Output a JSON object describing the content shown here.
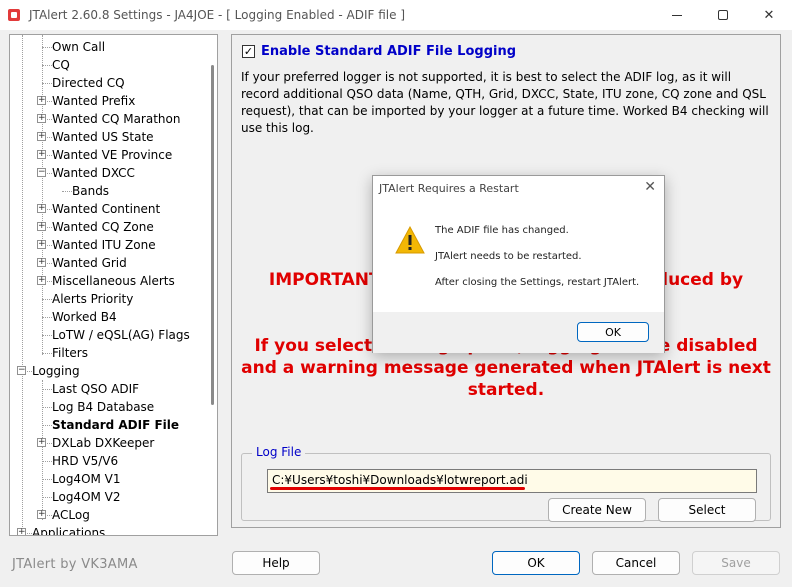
{
  "window": {
    "title": "JTAlert 2.60.8 Settings  -  JA4JOE  -  [ Logging Enabled - ADIF file ]",
    "controls": {
      "minimize": "minimize",
      "maximize": "maximize",
      "close": "✕"
    }
  },
  "tree": {
    "items": [
      {
        "label": "Own Call",
        "level": 2,
        "expander": ""
      },
      {
        "label": "CQ",
        "level": 2,
        "expander": ""
      },
      {
        "label": "Directed CQ",
        "level": 2,
        "expander": ""
      },
      {
        "label": "Wanted Prefix",
        "level": 2,
        "expander": "+"
      },
      {
        "label": "Wanted CQ Marathon",
        "level": 2,
        "expander": "+"
      },
      {
        "label": "Wanted US State",
        "level": 2,
        "expander": "+"
      },
      {
        "label": "Wanted VE Province",
        "level": 2,
        "expander": "+"
      },
      {
        "label": "Wanted DXCC",
        "level": 2,
        "expander": "−"
      },
      {
        "label": "Bands",
        "level": 3,
        "expander": ""
      },
      {
        "label": "Wanted Continent",
        "level": 2,
        "expander": "+"
      },
      {
        "label": "Wanted CQ Zone",
        "level": 2,
        "expander": "+"
      },
      {
        "label": "Wanted ITU Zone",
        "level": 2,
        "expander": "+"
      },
      {
        "label": "Wanted Grid",
        "level": 2,
        "expander": "+"
      },
      {
        "label": "Miscellaneous Alerts",
        "level": 2,
        "expander": "+"
      },
      {
        "label": "Alerts Priority",
        "level": 2,
        "expander": ""
      },
      {
        "label": "Worked B4",
        "level": 2,
        "expander": ""
      },
      {
        "label": "LoTW / eQSL(AG) Flags",
        "level": 2,
        "expander": ""
      },
      {
        "label": "Filters",
        "level": 2,
        "expander": ""
      },
      {
        "label": "Logging",
        "level": 1,
        "expander": "−"
      },
      {
        "label": "Last QSO ADIF",
        "level": 2,
        "expander": ""
      },
      {
        "label": "Log B4 Database",
        "level": 2,
        "expander": ""
      },
      {
        "label": "Standard ADIF File",
        "level": 2,
        "expander": "",
        "selected": true
      },
      {
        "label": "DXLab DXKeeper",
        "level": 2,
        "expander": "+"
      },
      {
        "label": "HRD V5/V6",
        "level": 2,
        "expander": ""
      },
      {
        "label": "Log4OM V1",
        "level": 2,
        "expander": ""
      },
      {
        "label": "Log4OM V2",
        "level": 2,
        "expander": ""
      },
      {
        "label": "ACLog",
        "level": 2,
        "expander": "+"
      },
      {
        "label": "Applications",
        "level": 1,
        "expander": "+"
      }
    ]
  },
  "panel": {
    "enable_checked": "✓",
    "enable_label": "Enable Standard ADIF File Logging",
    "description": "If your preferred logger is not supported, it is best to select the ADIF log, as it will record additional QSO data (Name, QTH, Grid, DXCC, State, ITU zone, CQ zone and QSL request), that can be imported by your logger at a future time. Worked B4 checking will use this log.",
    "important_line1": "IMPORTANT: Reduced function when produced by",
    "important_line2": "If you select this log option, logging will be disabled",
    "important_line3": "and a warning message generated when JTAlert is next",
    "important_line4": "started.",
    "log_file_legend": "Log File",
    "log_file_path": "C:¥Users¥toshi¥Downloads¥lotwreport.adi",
    "create_new": "Create New",
    "select": "Select"
  },
  "footer": {
    "brand": "JTAlert by VK3AMA",
    "help": "Help",
    "ok": "OK",
    "cancel": "Cancel",
    "save": "Save"
  },
  "modal": {
    "title": "JTAlert Requires a Restart",
    "close": "✕",
    "icon": "warning-icon",
    "line1": "The ADIF file has changed.",
    "line2": "JTAlert needs to be restarted.",
    "line3": "After closing the Settings, restart JTAlert.",
    "ok": "OK"
  },
  "colors": {
    "accent_blue": "#0000c8",
    "important_red": "#e00000",
    "input_bg": "#fffbe8"
  }
}
